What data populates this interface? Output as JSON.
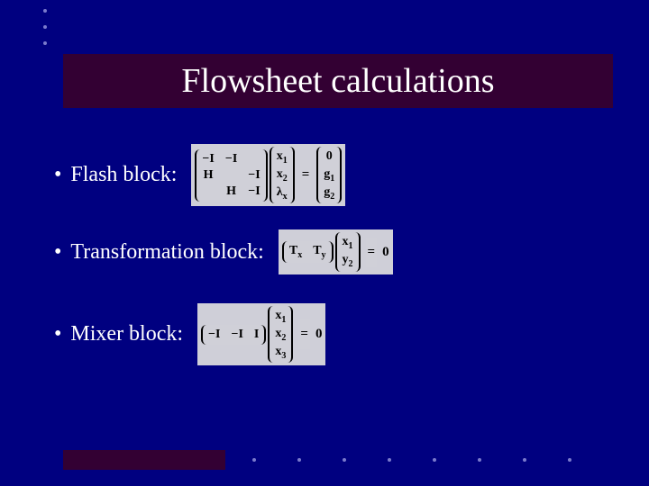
{
  "title": "Flowsheet calculations",
  "bullets": {
    "flash": {
      "label": "Flash block:",
      "matrix": [
        [
          "−I",
          "−I",
          ""
        ],
        [
          "H",
          "",
          "−I"
        ],
        [
          "",
          "H",
          "−I"
        ]
      ],
      "vec_x": [
        "x",
        "x",
        "λ"
      ],
      "vec_x_sub": [
        "1",
        "2",
        "x"
      ],
      "op": "=",
      "vec_r": [
        "0",
        "g",
        "g"
      ],
      "vec_r_sub": [
        "",
        "1",
        "2"
      ]
    },
    "transform": {
      "label": "Transformation block:",
      "row": [
        "T",
        "T"
      ],
      "row_sub": [
        "x",
        "y"
      ],
      "vec": [
        "x",
        "y"
      ],
      "vec_sub": [
        "1",
        "2"
      ],
      "op": "=",
      "rhs": "0"
    },
    "mixer": {
      "label": "Mixer block:",
      "row": [
        "−I",
        "−I",
        "I"
      ],
      "vec": [
        "x",
        "x",
        "x"
      ],
      "vec_sub": [
        "1",
        "2",
        "3"
      ],
      "op": "=",
      "rhs": "0"
    }
  }
}
